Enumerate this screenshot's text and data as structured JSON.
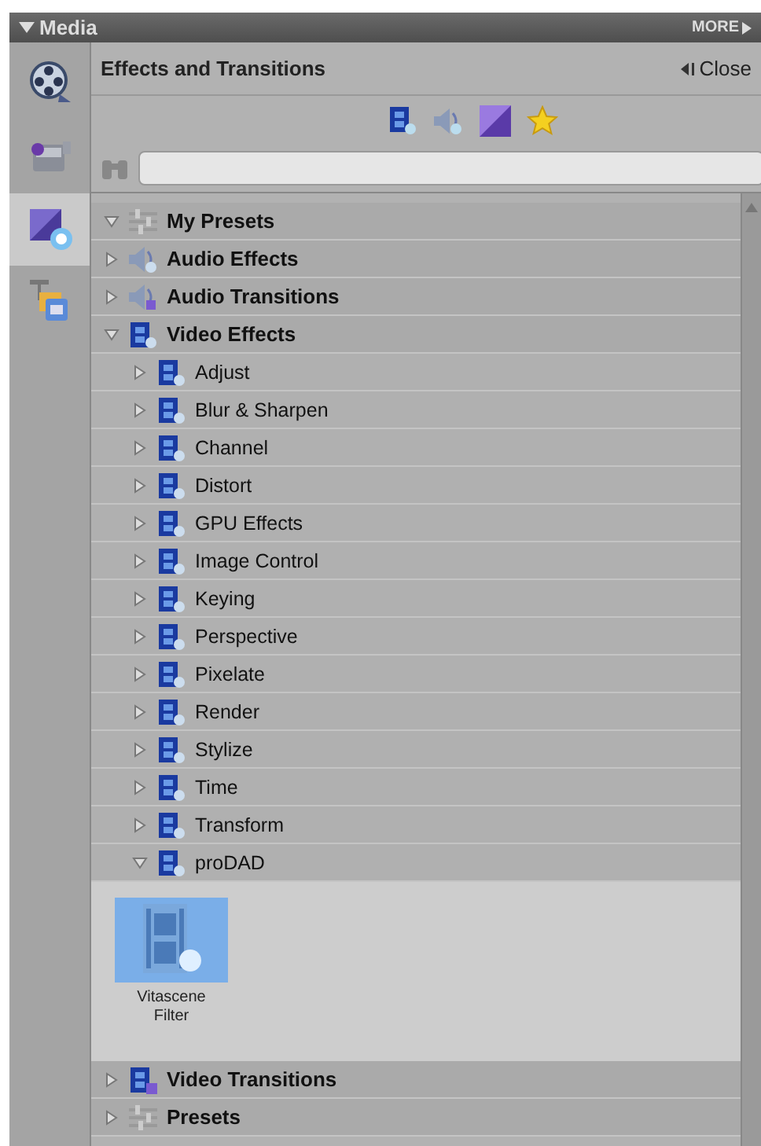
{
  "header": {
    "title": "Media",
    "more": "MORE"
  },
  "sidebar": {
    "tabs": [
      {
        "kind": "reel",
        "selected": false
      },
      {
        "kind": "camcorder",
        "selected": false
      },
      {
        "kind": "effects",
        "selected": true
      },
      {
        "kind": "titles",
        "selected": false
      }
    ]
  },
  "panel": {
    "title": "Effects and Transitions",
    "close": "Close",
    "filters": [
      {
        "kind": "video"
      },
      {
        "kind": "audio"
      },
      {
        "kind": "transition"
      },
      {
        "kind": "star"
      }
    ],
    "tree": [
      {
        "label": "My Presets",
        "kind": "presets",
        "expanded": true
      },
      {
        "label": "Audio Effects",
        "kind": "audio",
        "expanded": false
      },
      {
        "label": "Audio Transitions",
        "kind": "audio-transition",
        "expanded": false
      },
      {
        "label": "Video Effects",
        "kind": "video",
        "expanded": true,
        "children": [
          {
            "label": "Adjust",
            "kind": "video",
            "expanded": false
          },
          {
            "label": "Blur & Sharpen",
            "kind": "video",
            "expanded": false
          },
          {
            "label": "Channel",
            "kind": "video",
            "expanded": false
          },
          {
            "label": "Distort",
            "kind": "video",
            "expanded": false
          },
          {
            "label": "GPU Effects",
            "kind": "video",
            "expanded": false
          },
          {
            "label": "Image Control",
            "kind": "video",
            "expanded": false
          },
          {
            "label": "Keying",
            "kind": "video",
            "expanded": false
          },
          {
            "label": "Perspective",
            "kind": "video",
            "expanded": false
          },
          {
            "label": "Pixelate",
            "kind": "video",
            "expanded": false
          },
          {
            "label": "Render",
            "kind": "video",
            "expanded": false
          },
          {
            "label": "Stylize",
            "kind": "video",
            "expanded": false
          },
          {
            "label": "Time",
            "kind": "video",
            "expanded": false
          },
          {
            "label": "Transform",
            "kind": "video",
            "expanded": false
          },
          {
            "label": "proDAD",
            "kind": "video",
            "expanded": true,
            "items": [
              {
                "label": "Vitascene Filter",
                "selected": true
              }
            ]
          }
        ]
      },
      {
        "label": "Video Transitions",
        "kind": "video-transition",
        "expanded": false
      },
      {
        "label": "Presets",
        "kind": "presets",
        "expanded": false
      }
    ]
  }
}
